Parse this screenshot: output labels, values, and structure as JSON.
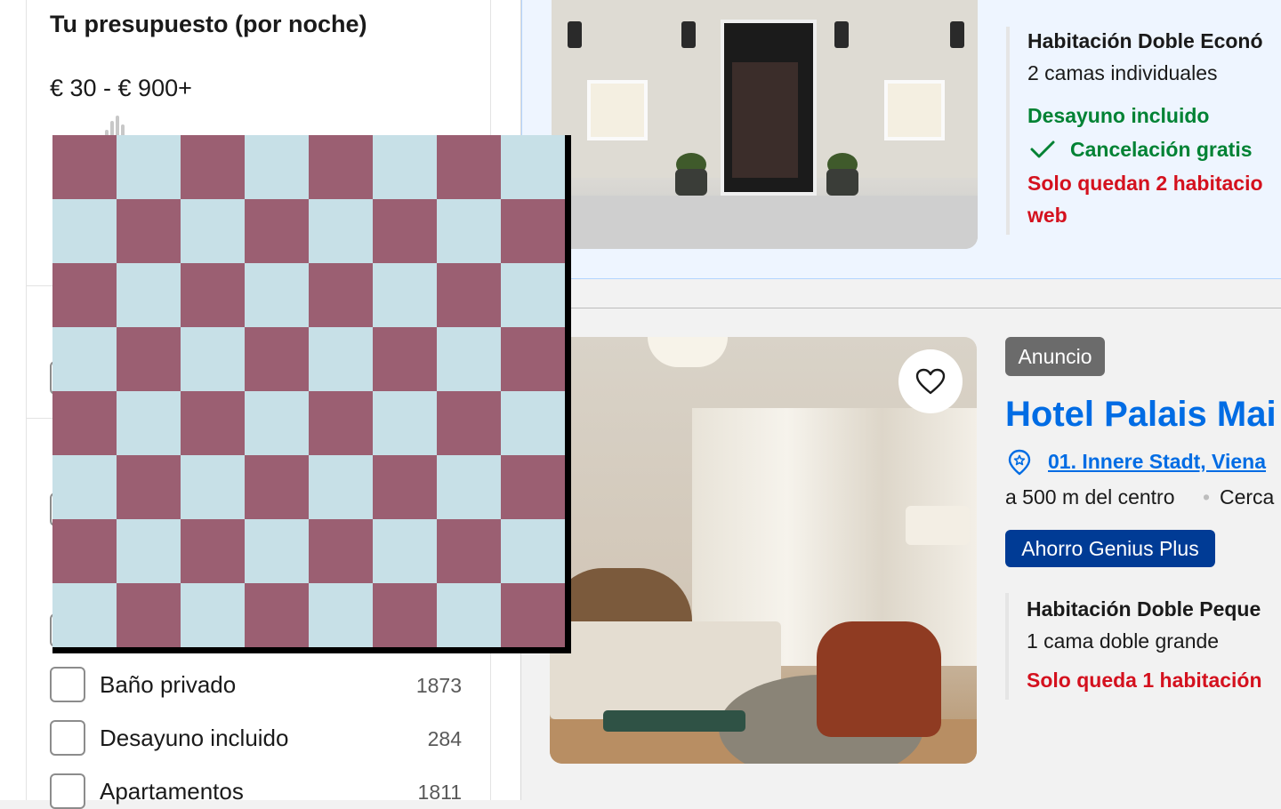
{
  "filters": {
    "budget": {
      "title": "Tu presupuesto (por noche)",
      "range": "€ 30 - € 900+"
    },
    "options": [
      {
        "label": "Baño privado",
        "count": "1873"
      },
      {
        "label": "Desayuno incluido",
        "count": "284"
      },
      {
        "label": "Apartamentos",
        "count": "1811"
      }
    ]
  },
  "results": [
    {
      "room_name": "Habitación Doble Econó",
      "beds": "2 camas individuales",
      "breakfast": "Desayuno incluido",
      "cancellation": "Cancelación gratis",
      "availability_line1": "Solo quedan 2 habitacio",
      "availability_line2": "web"
    },
    {
      "badge": "Anuncio",
      "name": "Hotel Palais Mai",
      "address": "01. Innere Stadt, Viena",
      "distance": "a 500 m del centro",
      "nearby": "Cerca",
      "deal_badge": "Ahorro Genius Plus",
      "room_name": "Habitación Doble Peque",
      "beds": "1 cama doble grande",
      "availability": "Solo queda 1 habitación"
    }
  ],
  "colors": {
    "link_blue": "#006ce4",
    "genius_blue": "#003b95",
    "success_green": "#008234",
    "urgent_red": "#d4111e",
    "checker_light": "#c7e0e7",
    "checker_dark": "#9b5f72"
  },
  "icons": [
    "check-icon",
    "heart-icon",
    "map-pin-icon"
  ]
}
